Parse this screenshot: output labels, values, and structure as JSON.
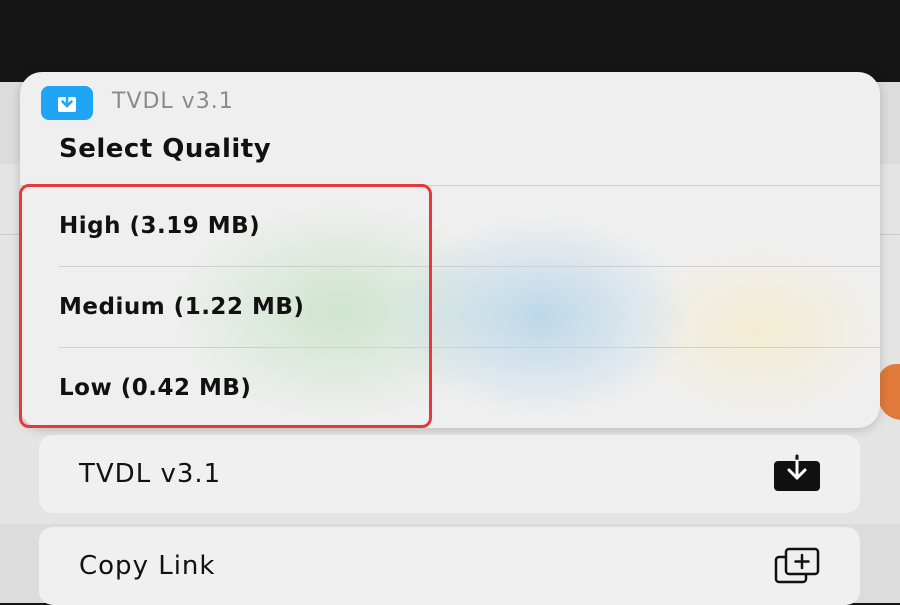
{
  "sheet": {
    "app_name": "TVDL v3.1",
    "app_icon": "download-box-icon",
    "title": "Select Quality",
    "options": [
      {
        "label": "High (3.19 MB)"
      },
      {
        "label": "Medium (1.22 MB)"
      },
      {
        "label": "Low (0.42 MB)"
      }
    ]
  },
  "actions": [
    {
      "label": "TVDL v3.1",
      "icon": "download-box-icon"
    },
    {
      "label": "Copy Link",
      "icon": "copy-plus-icon"
    }
  ],
  "colors": {
    "app_icon_blue": "#1ea5f4",
    "highlight_red": "#e8393a",
    "backdrop_dark": "#141514"
  }
}
